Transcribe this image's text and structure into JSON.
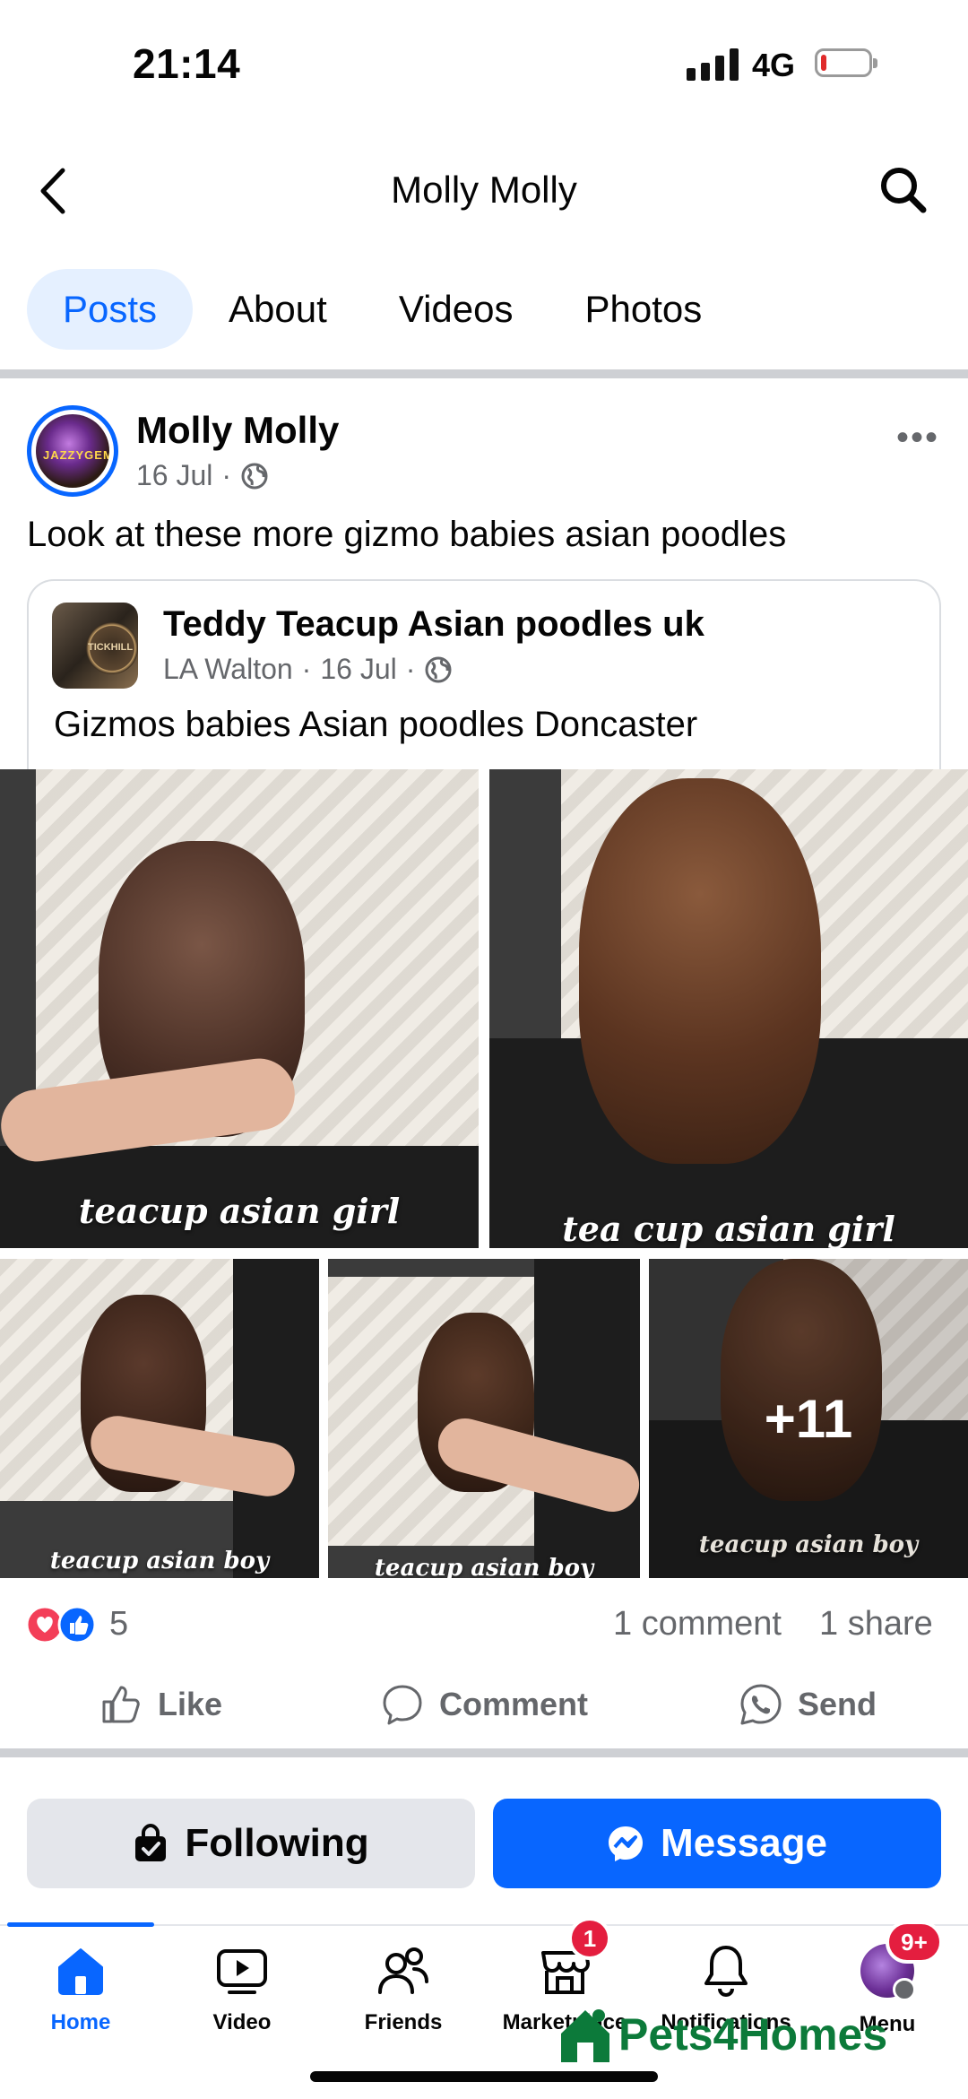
{
  "status_bar": {
    "time": "21:14",
    "network": "4G"
  },
  "header": {
    "title": "Molly Molly"
  },
  "tabs": [
    {
      "label": "Posts",
      "active": true
    },
    {
      "label": "About",
      "active": false
    },
    {
      "label": "Videos",
      "active": false
    },
    {
      "label": "Photos",
      "active": false
    }
  ],
  "post": {
    "author": "Molly Molly",
    "avatar_text": "JAZZYGEM",
    "date": "16 Jul",
    "separator": "·",
    "text": "Look at these more gizmo babies asian poodles",
    "shared": {
      "author": "Teddy Teacup Asian poodles uk",
      "avatar_text": "TICKHILL",
      "poster": "LA Walton",
      "date": "16 Jul",
      "text": "Gizmos babies Asian poodles Doncaster"
    },
    "photos": [
      {
        "caption": "teacup asian girl"
      },
      {
        "caption": "tea cup asian girl"
      },
      {
        "caption": "teacup asian boy"
      },
      {
        "caption": "teacup asian boy"
      },
      {
        "caption": "teacup asian boy",
        "more": "+11"
      }
    ],
    "reactions_count": "5",
    "comments": "1 comment",
    "shares": "1 share",
    "actions": {
      "like": "Like",
      "comment": "Comment",
      "send": "Send"
    }
  },
  "buttons": {
    "following": "Following",
    "message": "Message"
  },
  "bottom_nav": [
    {
      "label": "Home",
      "icon": "home-icon",
      "active": true
    },
    {
      "label": "Video",
      "icon": "video-icon"
    },
    {
      "label": "Friends",
      "icon": "friends-icon"
    },
    {
      "label": "Marketplace",
      "icon": "marketplace-icon",
      "badge": "1"
    },
    {
      "label": "Notifications",
      "icon": "bell-icon"
    },
    {
      "label": "Menu",
      "icon": "menu-avatar-icon",
      "badge": "9+"
    }
  ],
  "watermark": "Pets4Homes",
  "colors": {
    "accent": "#0866ff",
    "badge": "#e41e3f",
    "secondary_text": "#65676b"
  }
}
